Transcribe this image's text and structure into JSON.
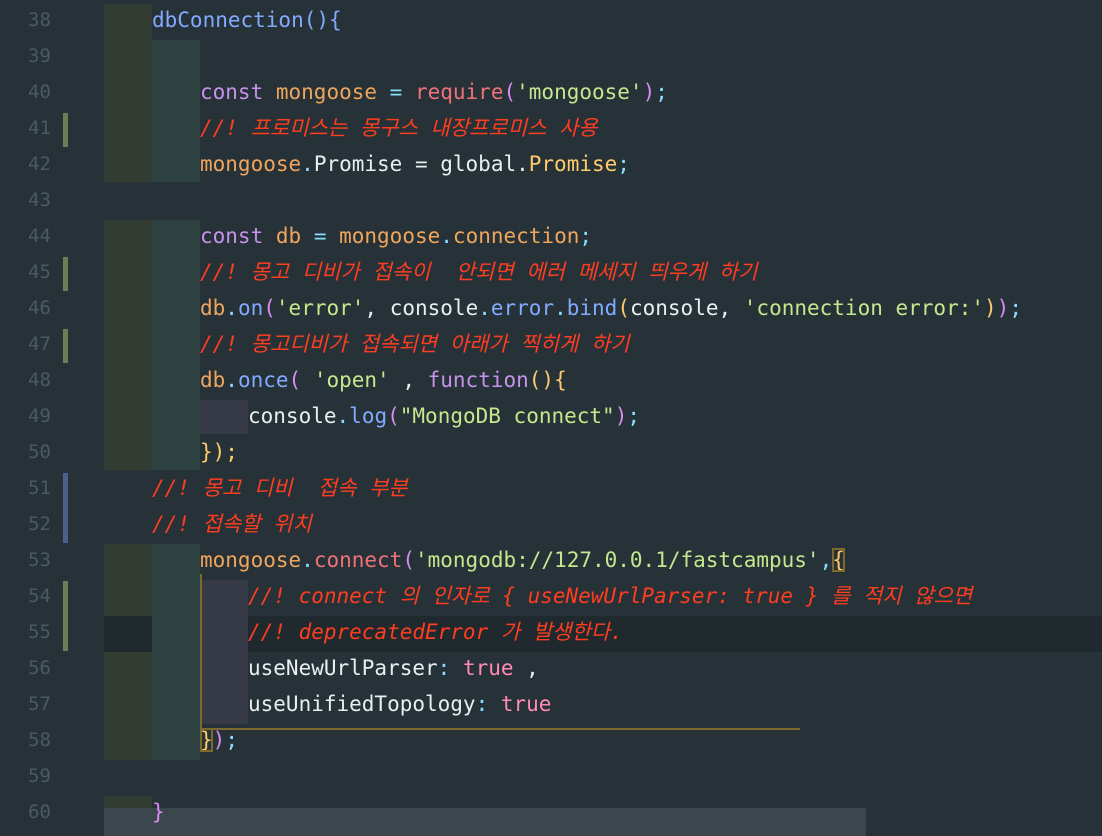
{
  "editor": {
    "line_numbers": [
      "38",
      "39",
      "40",
      "41",
      "42",
      "43",
      "44",
      "45",
      "46",
      "47",
      "48",
      "49",
      "50",
      "51",
      "52",
      "53",
      "54",
      "55",
      "56",
      "57",
      "58",
      "59",
      "60"
    ],
    "colors": {
      "background": "#263238",
      "comment": "#ff3d1f",
      "keyword": "#c792ea",
      "string": "#c3e88d",
      "function": "#82aaff"
    },
    "lines": {
      "l38": "dbConnection(){",
      "l40_kw": "const",
      "l40_var": "mongoose",
      "l40_eq": " = ",
      "l40_req": "require",
      "l40_str": "'mongoose'",
      "l41": "//! 프로미스는 몽구스 내장프로미스 사용",
      "l42_a": "mongoose",
      "l42_b": "Promise",
      "l42_c": " = global.",
      "l42_d": "Promise",
      "l44_kw": "const",
      "l44_var": "db",
      "l44_a": "mongoose",
      "l44_b": "connection",
      "l45": "//! 몽고 디비가 접속이  안되면 에러 메세지 띄우게 하기",
      "l46_a": "db",
      "l46_b": "on",
      "l46_str1": "'error'",
      "l46_c": ", console",
      "l46_d": "error",
      "l46_e": "bind",
      "l46_f": "console, ",
      "l46_str2": "'connection error:'",
      "l47": "//! 몽고디비가 접속되면 아래가 찍히게 하기",
      "l48_a": "db",
      "l48_b": "once",
      "l48_str": "'open'",
      "l48_c": " , ",
      "l48_fn": "function",
      "l49_a": "console",
      "l49_b": "log",
      "l49_str": "\"MongoDB connect\"",
      "l50": "});",
      "l51": "//! 몽고 디비  접속 부분",
      "l52": "//! 접속할 위치",
      "l53_a": "mongoose",
      "l53_b": "connect",
      "l53_str": "'mongodb://127.0.0.1/fastcampus'",
      "l54": "//! connect 의 인자로 { useNewUrlParser: true } 를 적지 않으면",
      "l55": "//! deprecatedError 가 발생한다.",
      "l56_a": "useNewUrlParser",
      "l56_b": "true",
      "l57_a": "useUnifiedTopology",
      "l57_b": "true",
      "l58": "});",
      "l60": "}"
    }
  }
}
